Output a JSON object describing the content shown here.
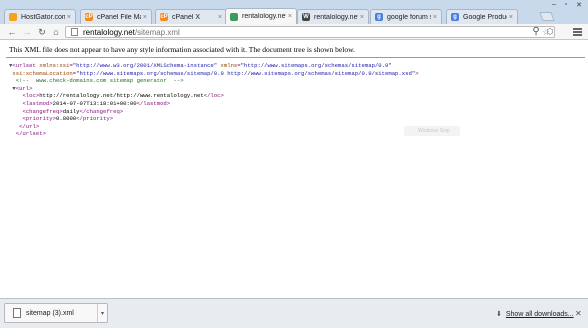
{
  "browser": {
    "tabs": [
      {
        "label": "HostGator.com",
        "favicon": "hostgator-icon",
        "color": "#f7a21b",
        "glyph": ""
      },
      {
        "label": "cPanel File Manag",
        "favicon": "cpanel-icon",
        "color": "#f08a24",
        "glyph": "cP"
      },
      {
        "label": "cPanel X",
        "favicon": "cpanel-icon",
        "color": "#f08a24",
        "glyph": "cP"
      },
      {
        "label": "rentalology.net/s",
        "favicon": "globe-icon",
        "color": "#3b9b5a",
        "glyph": ""
      },
      {
        "label": "rentalology.net",
        "favicon": "wordpress-icon",
        "color": "#444444",
        "glyph": "W"
      },
      {
        "label": "google forum sit",
        "favicon": "google-icon",
        "color": "#4a7ddb",
        "glyph": "g"
      },
      {
        "label": "Google Product F",
        "favicon": "google-product-icon",
        "color": "#4a7ddb",
        "glyph": "g"
      }
    ],
    "url_host": "rentalology.net",
    "url_path": "/sitemap.xml"
  },
  "content": {
    "notice": "This XML file does not appear to have any style information associated with it. The document tree is shown below.",
    "xml_lines": [
      {
        "indent": "",
        "segments": [
          {
            "t": "arrow",
            "v": "▼"
          },
          {
            "t": "tag",
            "v": "<urlset"
          },
          {
            "t": "attr",
            "v": " xmlns:xsi"
          },
          {
            "t": "tag",
            "v": "="
          },
          {
            "t": "val",
            "v": "\"http://www.w3.org/2001/XMLSchema-instance\""
          },
          {
            "t": "attr",
            "v": " xmlns"
          },
          {
            "t": "tag",
            "v": "="
          },
          {
            "t": "val",
            "v": "\"http://www.sitemaps.org/schemas/sitemap/0.9\""
          }
        ]
      },
      {
        "indent": " ",
        "segments": [
          {
            "t": "attr",
            "v": "xsi:schemaLocation"
          },
          {
            "t": "tag",
            "v": "="
          },
          {
            "t": "val",
            "v": "\"http://www.sitemaps.org/schemas/sitemap/0.9 http://www.sitemaps.org/schemas/sitemap/0.9/sitemap.xsd\""
          },
          {
            "t": "tag",
            "v": ">"
          }
        ]
      },
      {
        "indent": "  ",
        "segments": [
          {
            "t": "cmt",
            "v": "<!--  www.check-domains.com sitemap generator  -->"
          }
        ]
      },
      {
        "indent": " ",
        "segments": [
          {
            "t": "arrow",
            "v": "▼"
          },
          {
            "t": "tag",
            "v": "<url>"
          }
        ]
      },
      {
        "indent": "    ",
        "segments": [
          {
            "t": "tag",
            "v": "<loc>"
          },
          {
            "t": "txt",
            "v": "http://rentalology.net/http://www.rentalology.net"
          },
          {
            "t": "tag",
            "v": "</loc>"
          }
        ]
      },
      {
        "indent": "    ",
        "segments": [
          {
            "t": "tag",
            "v": "<lastmod>"
          },
          {
            "t": "txt",
            "v": "2014-07-07T13:18:01+00:00"
          },
          {
            "t": "tag",
            "v": "</lastmod>"
          }
        ]
      },
      {
        "indent": "    ",
        "segments": [
          {
            "t": "tag",
            "v": "<changefreq>"
          },
          {
            "t": "txt",
            "v": "daily"
          },
          {
            "t": "tag",
            "v": "</changefreq>"
          }
        ]
      },
      {
        "indent": "    ",
        "segments": [
          {
            "t": "tag",
            "v": "<priority>"
          },
          {
            "t": "txt",
            "v": "0.8000"
          },
          {
            "t": "tag",
            "v": "</priority>"
          }
        ]
      },
      {
        "indent": "   ",
        "segments": [
          {
            "t": "tag",
            "v": "</url>"
          }
        ]
      },
      {
        "indent": "  ",
        "segments": [
          {
            "t": "tag",
            "v": "</urlset>"
          }
        ]
      }
    ],
    "ghost_button": "Windows Snip"
  },
  "download_shelf": {
    "filename": "sitemap (3).xml",
    "show_all_label": "Show all downloads..."
  }
}
